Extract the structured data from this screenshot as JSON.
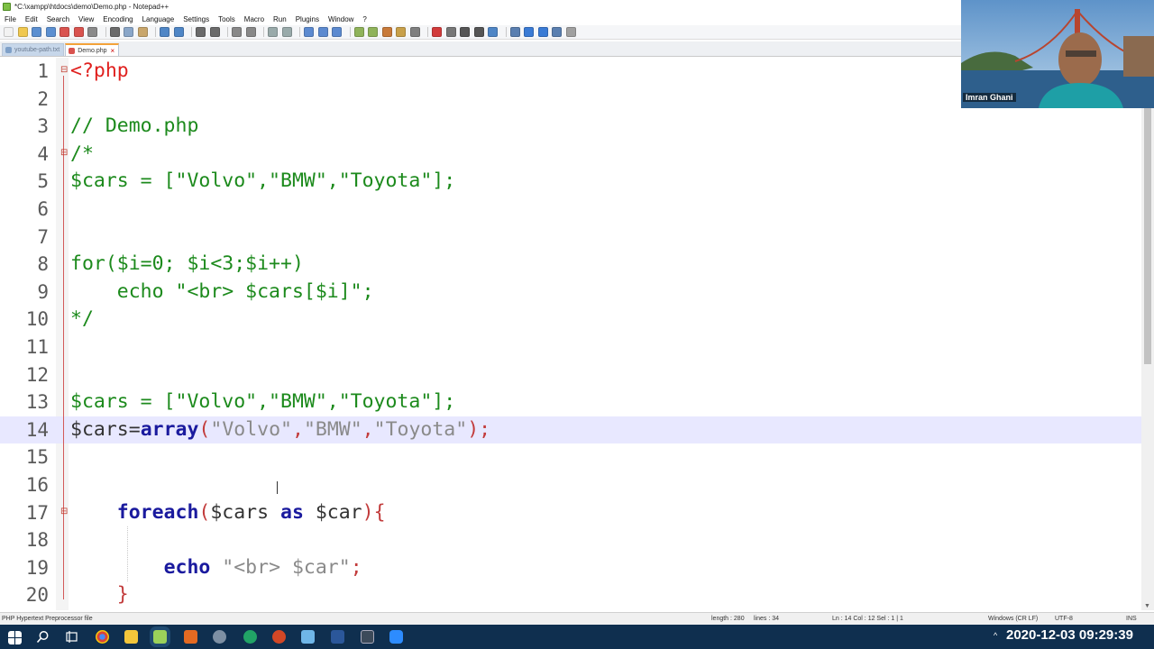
{
  "window": {
    "title": "*C:\\xampp\\htdocs\\demo\\Demo.php - Notepad++"
  },
  "menu": {
    "items": [
      "File",
      "Edit",
      "Search",
      "View",
      "Encoding",
      "Language",
      "Settings",
      "Tools",
      "Macro",
      "Run",
      "Plugins",
      "Window",
      "?"
    ]
  },
  "tabs": [
    {
      "label": "youtube-path.txt",
      "active": false
    },
    {
      "label": "Demo.php",
      "active": true
    }
  ],
  "editor": {
    "current_line": 14,
    "lines": [
      {
        "n": "1",
        "tokens": [
          {
            "t": "<?php",
            "c": "c-tag"
          }
        ]
      },
      {
        "n": "2",
        "tokens": []
      },
      {
        "n": "3",
        "tokens": [
          {
            "t": "// Demo.php",
            "c": "c-comment"
          }
        ]
      },
      {
        "n": "4",
        "tokens": [
          {
            "t": "/*",
            "c": "c-comment"
          }
        ]
      },
      {
        "n": "5",
        "tokens": [
          {
            "t": "$cars = [\"Volvo\",\"BMW\",\"Toyota\"];",
            "c": "c-comment"
          }
        ]
      },
      {
        "n": "6",
        "tokens": []
      },
      {
        "n": "7",
        "tokens": []
      },
      {
        "n": "8",
        "tokens": [
          {
            "t": "for($i=0; $i<3;$i++)",
            "c": "c-comment"
          }
        ]
      },
      {
        "n": "9",
        "tokens": [
          {
            "t": "    echo \"<br> $cars[$i]\";",
            "c": "c-comment"
          }
        ]
      },
      {
        "n": "10",
        "tokens": [
          {
            "t": "*/",
            "c": "c-comment"
          }
        ]
      },
      {
        "n": "11",
        "tokens": []
      },
      {
        "n": "12",
        "tokens": []
      },
      {
        "n": "13",
        "tokens": [
          {
            "t": "$cars = [\"Volvo\",\"BMW\",\"Toyota\"];",
            "c": "c-comment"
          }
        ]
      },
      {
        "n": "14",
        "tokens": [
          {
            "t": "$cars",
            "c": "c-var"
          },
          {
            "t": "=",
            "c": "c-plain"
          },
          {
            "t": "array",
            "c": "c-kw"
          },
          {
            "t": "(",
            "c": "c-op"
          },
          {
            "t": "\"Volvo\"",
            "c": "c-str"
          },
          {
            "t": ",",
            "c": "c-op"
          },
          {
            "t": "\"BMW\"",
            "c": "c-str"
          },
          {
            "t": ",",
            "c": "c-op"
          },
          {
            "t": "\"Toyota\"",
            "c": "c-str"
          },
          {
            "t": ")",
            "c": "c-op"
          },
          {
            "t": ";",
            "c": "c-op"
          }
        ]
      },
      {
        "n": "15",
        "tokens": []
      },
      {
        "n": "16",
        "tokens": []
      },
      {
        "n": "17",
        "tokens": [
          {
            "t": "    ",
            "c": "c-plain"
          },
          {
            "t": "foreach",
            "c": "c-kw"
          },
          {
            "t": "(",
            "c": "c-op"
          },
          {
            "t": "$cars ",
            "c": "c-var"
          },
          {
            "t": "as",
            "c": "c-kw"
          },
          {
            "t": " $car",
            "c": "c-var"
          },
          {
            "t": "){",
            "c": "c-op"
          }
        ]
      },
      {
        "n": "18",
        "tokens": []
      },
      {
        "n": "19",
        "tokens": [
          {
            "t": "        ",
            "c": "c-plain"
          },
          {
            "t": "echo",
            "c": "c-kw"
          },
          {
            "t": " ",
            "c": "c-plain"
          },
          {
            "t": "\"<br> $car\"",
            "c": "c-str"
          },
          {
            "t": ";",
            "c": "c-op"
          }
        ]
      },
      {
        "n": "20",
        "tokens": [
          {
            "t": "    ",
            "c": "c-plain"
          },
          {
            "t": "}",
            "c": "c-op"
          }
        ]
      }
    ]
  },
  "status": {
    "file_type": "PHP Hypertext Preprocessor file",
    "length": "length : 280",
    "lines": "lines : 34",
    "position": "Ln : 14    Col : 12    Sel : 1 | 1",
    "eol": "Windows (CR LF)",
    "encoding": "UTF-8",
    "mode": "INS"
  },
  "webcam": {
    "name": "Imran Ghani"
  },
  "taskbar": {
    "clock": "2020-12-03  09:29:39"
  },
  "colors": {
    "current_line_bg": "#e8e8ff",
    "php_tag": "#e0201e",
    "comment": "#1c8a1c",
    "keyword": "#1a1a9e",
    "string": "#8a8a8a",
    "operator": "#c23b3b",
    "taskbar_bg": "#0f2f4f"
  }
}
